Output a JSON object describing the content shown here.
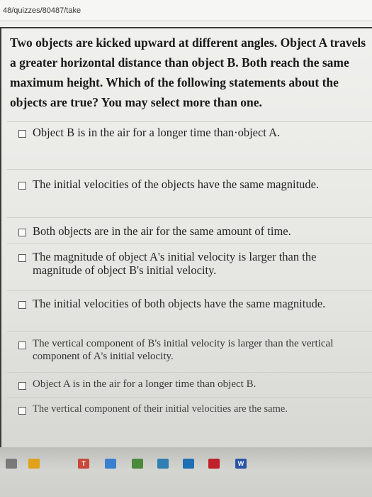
{
  "browser": {
    "url": "48/quizzes/80487/take"
  },
  "question": {
    "text": "Two objects are kicked upward at different angles. Object A travels a greater horizontal distance than object B. Both reach the same maximum height. Which of the following statements about the objects are true? You may select more than one."
  },
  "options": [
    {
      "label": "Object B is in the air for a longer time than·object A."
    },
    {
      "label": "The initial velocities of the objects have the same magnitude."
    },
    {
      "label": "Both objects are in the air for the same amount of time."
    },
    {
      "label": "The magnitude of object A's initial velocity is larger than the magnitude of object B's initial velocity."
    },
    {
      "label": "The initial velocities of both objects have the same magnitude."
    },
    {
      "label": "The vertical component of B's initial velocity is larger than the vertical component of A's initial velocity."
    },
    {
      "label": "Object A is in the air for a longer time than object B."
    },
    {
      "label": "The vertical component of their initial velocities are the same."
    }
  ],
  "taskbar": {
    "icons": [
      {
        "name": "start-icon",
        "color": "#7a7a7a"
      },
      {
        "name": "store-icon",
        "color": "#e0a21a"
      },
      {
        "name": "t-app-icon",
        "color": "#c8483a",
        "text": "T"
      },
      {
        "name": "drive-icon",
        "color": "#3a7fd0"
      },
      {
        "name": "app-icon",
        "color": "#4a8a3a"
      },
      {
        "name": "photos-icon",
        "color": "#2f7fb3"
      },
      {
        "name": "mail-icon",
        "color": "#1e6fb3"
      },
      {
        "name": "acrobat-icon",
        "color": "#c0202a"
      },
      {
        "name": "word-icon",
        "color": "#2a56a6",
        "text": "W"
      }
    ]
  }
}
